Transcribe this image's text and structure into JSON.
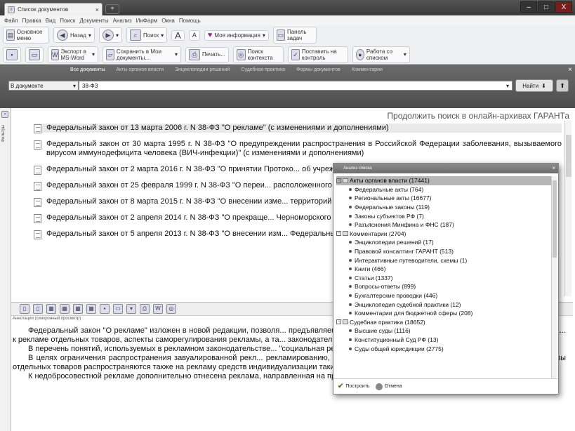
{
  "window": {
    "tab_title": "Список документов",
    "tab_close": "×",
    "new_tab": "+"
  },
  "winbuttons": {
    "min": "–",
    "max": "□",
    "close": "X"
  },
  "menu": [
    "Файл",
    "Правка",
    "Вид",
    "Поиск",
    "Документы",
    "Анализ",
    "ИнФарм",
    "Окна",
    "Помощь"
  ],
  "toolbar1": {
    "main_menu": "Основное меню",
    "back": "Назад",
    "search": "Поиск",
    "font_up": "A",
    "font_down": "A",
    "my_info": "Моя информация",
    "tasks": "Панель задач"
  },
  "toolbar2": {
    "export": "Экспорт в MS-Word",
    "save": "Сохранить в Мои документы...",
    "print": "Печать...",
    "search_context": "Поиск контекста",
    "control": "Поставить на контроль",
    "work_list": "Работа со списком"
  },
  "searchpanel": {
    "tabs": [
      "Все документы",
      "Акты органов власти",
      "Энциклопедии решений",
      "Судебная практика",
      "Формы документов",
      "Комментарии"
    ],
    "scope": "В документе",
    "query": "38-ФЗ",
    "find": "Найти",
    "close": "×"
  },
  "continue_link": "Продолжить поиск в онлайн-архивах ГАРАНТа",
  "side_label": "Фильтры",
  "documents": [
    "Федеральный закон от 13 марта 2006 г. N 38-ФЗ \"О рекламе\" (с изменениями и дополнениями)",
    "Федеральный закон от 30 марта 1995 г. N 38-ФЗ \"О предупреждении распространения в Российской Федерации заболевания, вызываемого вирусом иммунодефицита человека (ВИЧ-инфекции)\" (с изменениями и дополнениями)",
    "Федеральный закон от 2 марта 2016 г. N 38-ФЗ \"О принятии Протоко... об учреждении Всемирной торговой организации\"",
    "Федеральный закон от 25 февраля 1999 г. N 38-ФЗ \"О переи... расположенного в пределах закрытого административно-территориал...",
    "Федеральный закон от 8 марта 2015 г. N 38-ФЗ \"О внесении изме... территорий от чрезвычайных ситуаций природного и техногенного хар...",
    "Федеральный закон от 2 апреля 2014 г. N 38-ФЗ \"О прекраще... Черноморского флота Российской Федерации на территории Украины...",
    "Федеральный закон от 5 апреля 2013 г. N 38-ФЗ \"О внесении изм... Федеральный закон \"О Фонде содействия реформированию жилищно..."
  ],
  "annotation_label": "Аннотация (синхронный просмотр)",
  "annotation": [
    "Федеральный закон \"О рекламе\" изложен в новой редакции, позволя... предъявляемые к рекламе, определить особенности способов распростра... к рекламе отдельных товаров, аспекты саморегулирования рекламы, а та... законодательства.",
    "В перечень понятий, используемых в рекламном законодательстве... \"социальная реклама\", \"антимонопольный орган\".",
    "В целях ограничения распространения завуалированной рекл... рекламированию, специальные требования и ограничения в отношении рекламы отдельных товаров распространяются также на рекламу средств индивидуализации таких товаров, их изготовителей и продавцов.",
    "К недобросовестной рекламе дополнительно отнесена реклама, направленная на продвижение товара, в отношении"
  ],
  "popup": {
    "title": "Анализ списка",
    "close": "×",
    "groups": [
      {
        "label": "Акты органов власти (17441)",
        "items": [
          "Федеральные акты (764)",
          "Региональные акты (16677)",
          "Федеральные законы (119)",
          "Законы субъектов РФ (7)",
          "Разъяснения Минфина и ФНС (187)"
        ]
      },
      {
        "label": "Комментарии (2704)",
        "items": [
          "Энциклопедии решений (17)",
          "Правовой консалтинг ГАРАНТ (513)",
          "Интерактивные путеводители, схемы (1)",
          "Книги (466)",
          "Статьи (1337)",
          "Вопросы-ответы (899)",
          "Бухгалтерские проводки (446)",
          "Энциклопедия судебной практики (12)",
          "Комментарии для бюджетной сферы (208)"
        ]
      },
      {
        "label": "Судебная практика (18652)",
        "items": [
          "Высшие суды (1116)",
          "Конституционный Суд РФ (13)",
          "Суды общей юрисдикции (2775)"
        ]
      }
    ],
    "build": "Построить",
    "cancel": "Отмена"
  }
}
